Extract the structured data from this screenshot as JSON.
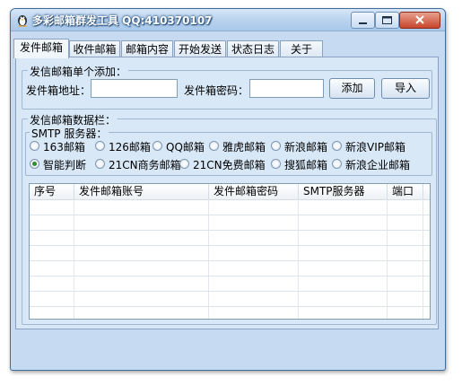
{
  "window": {
    "title": "多彩邮箱群发工具  QQ:410370107"
  },
  "tabs": [
    "发件邮箱",
    "收件邮箱",
    "邮箱内容",
    "开始发送",
    "状态日志",
    "关于"
  ],
  "single_add": {
    "legend": "发信邮箱单个添加：",
    "address_label": "发件箱地址：",
    "address_value": "",
    "password_label": "发件箱密码：",
    "password_value": "",
    "add_button": "添加",
    "import_button": "导入"
  },
  "data_section": {
    "legend": "发信邮箱数据栏：",
    "smtp_legend": "SMTP 服务器：",
    "smtp_options": [
      {
        "label": "163邮箱",
        "selected": false
      },
      {
        "label": "126邮箱",
        "selected": false
      },
      {
        "label": "QQ邮箱",
        "selected": false
      },
      {
        "label": "雅虎邮箱",
        "selected": false
      },
      {
        "label": "新浪邮箱",
        "selected": false
      },
      {
        "label": "新浪VIP邮箱",
        "selected": false
      },
      {
        "label": "智能判断",
        "selected": true
      },
      {
        "label": "21CN商务邮箱",
        "selected": false
      },
      {
        "label": "21CN免费邮箱",
        "selected": false
      },
      {
        "label": "搜狐邮箱",
        "selected": false
      },
      {
        "label": "新浪企业邮箱",
        "selected": false
      }
    ],
    "columns": [
      "序号",
      "发件邮箱账号",
      "发件邮箱密码",
      "SMTP服务器",
      "端口"
    ],
    "rows": []
  },
  "colors": {
    "accent": "#2f8f2f",
    "frame": "#c6dbf1",
    "panel": "#d9e8f7"
  }
}
